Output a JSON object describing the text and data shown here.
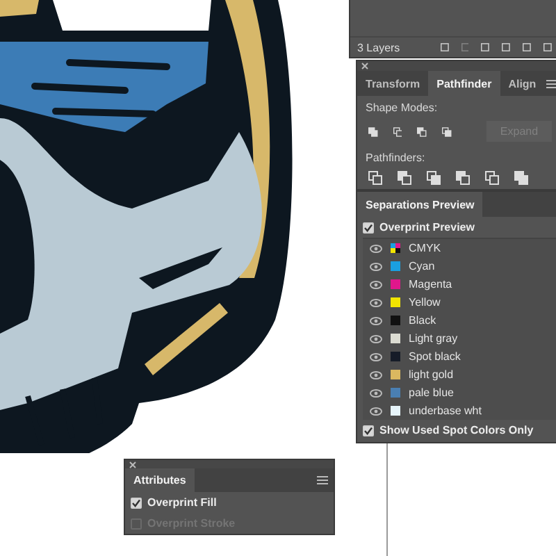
{
  "layers_panel": {
    "count_label": "3 Layers"
  },
  "pathfinder_panel": {
    "tabs": [
      {
        "label": "Transform",
        "selected": false
      },
      {
        "label": "Pathfinder",
        "selected": true
      },
      {
        "label": "Align",
        "selected": false
      }
    ],
    "shape_modes_label": "Shape Modes:",
    "expand_button": {
      "label": "Expand",
      "disabled": true
    },
    "pathfinders_label": "Pathfinders:"
  },
  "separations_panel": {
    "tab": "Separations Preview",
    "overprint_preview": {
      "label": "Overprint Preview",
      "checked": true
    },
    "separations": [
      {
        "name": "CMYK",
        "kind": "composite",
        "visible": true
      },
      {
        "name": "Cyan",
        "kind": "swatch",
        "color": "#1a9fe0",
        "visible": true
      },
      {
        "name": "Magenta",
        "kind": "swatch",
        "color": "#e0178c",
        "visible": true
      },
      {
        "name": "Yellow",
        "kind": "swatch",
        "color": "#f2e400",
        "visible": true
      },
      {
        "name": "Black",
        "kind": "swatch",
        "color": "#111111",
        "visible": true
      },
      {
        "name": "Light gray",
        "kind": "swatch",
        "color": "#dcdcd2",
        "visible": true
      },
      {
        "name": "Spot black",
        "kind": "swatch",
        "color": "#161c28",
        "visible": true
      },
      {
        "name": "light gold",
        "kind": "swatch",
        "color": "#dab860",
        "visible": true
      },
      {
        "name": "pale blue",
        "kind": "swatch",
        "color": "#4a7fb2",
        "visible": true
      },
      {
        "name": "underbase wht",
        "kind": "swatch",
        "color": "#e6f4fa",
        "visible": true
      }
    ],
    "show_used_spot": {
      "label": "Show Used Spot Colors Only",
      "checked": true
    }
  },
  "attributes_panel": {
    "tab": "Attributes",
    "options": [
      {
        "label": "Overprint Fill",
        "checked": true,
        "disabled": false
      },
      {
        "label": "Overprint Stroke",
        "checked": false,
        "disabled": true
      }
    ]
  }
}
